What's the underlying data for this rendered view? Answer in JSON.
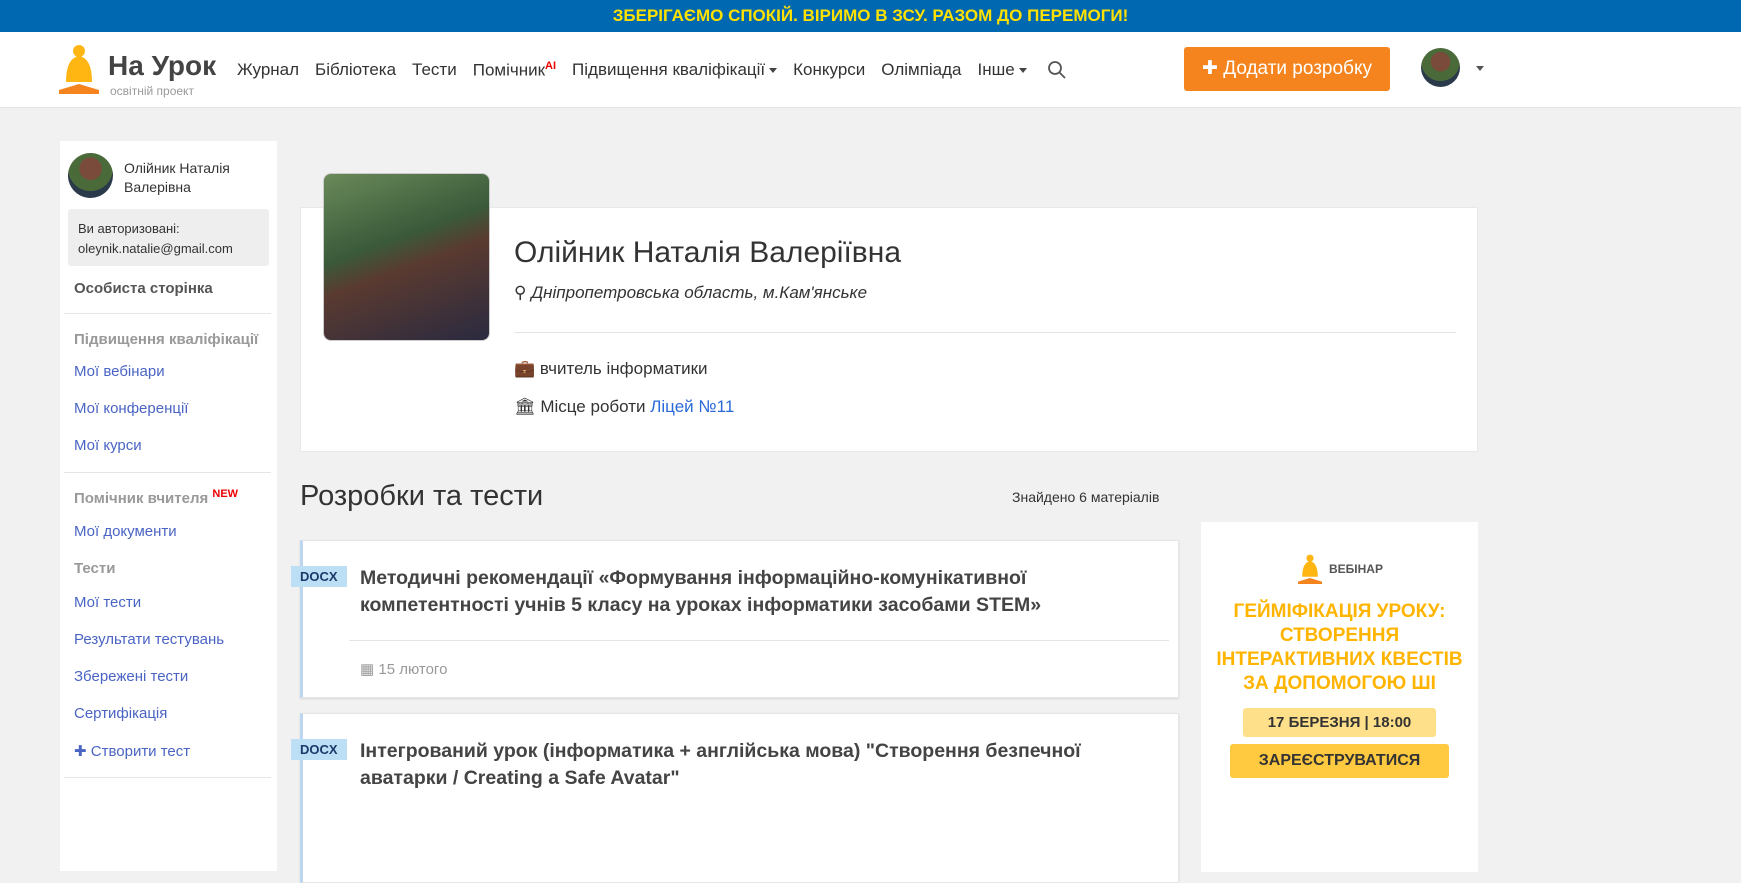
{
  "banner": "ЗБЕРІГАЄМО СПОКІЙ. ВІРИМО В ЗСУ. РАЗОМ ДО ПЕРЕМОГИ!",
  "logo": {
    "title": "На Урок",
    "subtitle": "освітній проект"
  },
  "nav": {
    "journal": "Журнал",
    "library": "Бібліотека",
    "tests": "Тести",
    "helper": "Помічник",
    "helper_badge": "AI",
    "qualification": "Підвищення кваліфікації",
    "contests": "Конкурси",
    "olympiad": "Олімпіада",
    "other": "Інше"
  },
  "add_button": "Додати розробку",
  "sidebar": {
    "name": "Олійник Наталія Валерівна",
    "auth_label": "Ви авторизовані:",
    "email": "oleynik.natalie@gmail.com",
    "personal": "Особиста сторінка",
    "qual_header": "Підвищення кваліфікації",
    "webinars": "Мої вебінари",
    "conferences": "Мої конференції",
    "courses": "Мої курси",
    "helper_header": "Помічник вчителя",
    "helper_new": "NEW",
    "documents": "Мої документи",
    "tests_header": "Тести",
    "my_tests": "Мої тести",
    "results": "Результати тестувань",
    "saved": "Збережені тести",
    "cert": "Сертифікація",
    "create_test": "Створити тест"
  },
  "profile": {
    "name": "Олійник Наталія Валеріївна",
    "location": "Дніпропетровська область, м.Кам'янське",
    "position": "вчитель інформатики",
    "work_label": "Місце роботи",
    "work_place": "Ліцей №11"
  },
  "materials": {
    "title": "Розробки та тести",
    "found": "Знайдено 6 матеріалів",
    "items": [
      {
        "type": "DOCX",
        "title": "Методичні рекомендації «Формування інформаційно-комунікативної компетентності учнів 5 класу на уроках інформатики засобами STEM»",
        "date": "15 лютого"
      },
      {
        "type": "DOCX",
        "title": "Інтегрований урок (інформатика + англійська мова) \"Створення безпечної аватарки / Creating a Safe Avatar\""
      }
    ]
  },
  "ad": {
    "label": "ВЕБІНАР",
    "title": "ГЕЙМІФІКАЦІЯ УРОКУ: СТВОРЕННЯ ІНТЕРАКТИВНИХ КВЕСТІВ ЗА ДОПОМОГОЮ ШІ",
    "date": "17 БЕРЕЗНЯ | 18:00",
    "register": "ЗАРЕЄСТРУВАТИСЯ"
  }
}
